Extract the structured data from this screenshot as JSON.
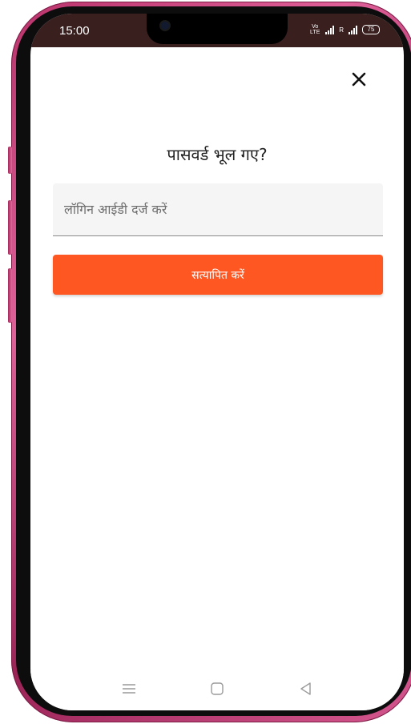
{
  "status_bar": {
    "time": "15:00",
    "network_label": "Vo LTE",
    "sim2_label": "R",
    "battery": "75"
  },
  "icons": {
    "close": "close-icon",
    "camera": "front-camera",
    "signal": "signal-icon",
    "battery": "battery-icon",
    "nav_menu": "menu-icon",
    "nav_home": "home-icon",
    "nav_back": "back-icon"
  },
  "page": {
    "title": "पासवर्ड भूल गए?",
    "login_input": {
      "value": "",
      "placeholder": "लॉगिन आईडी दर्ज करें"
    },
    "verify_button": "सत्यापित करें"
  },
  "colors": {
    "accent": "#ff5722",
    "status_bar_bg": "#3a1f1f",
    "input_bg": "#f5f5f5",
    "phone_frame": "#c93a75"
  }
}
